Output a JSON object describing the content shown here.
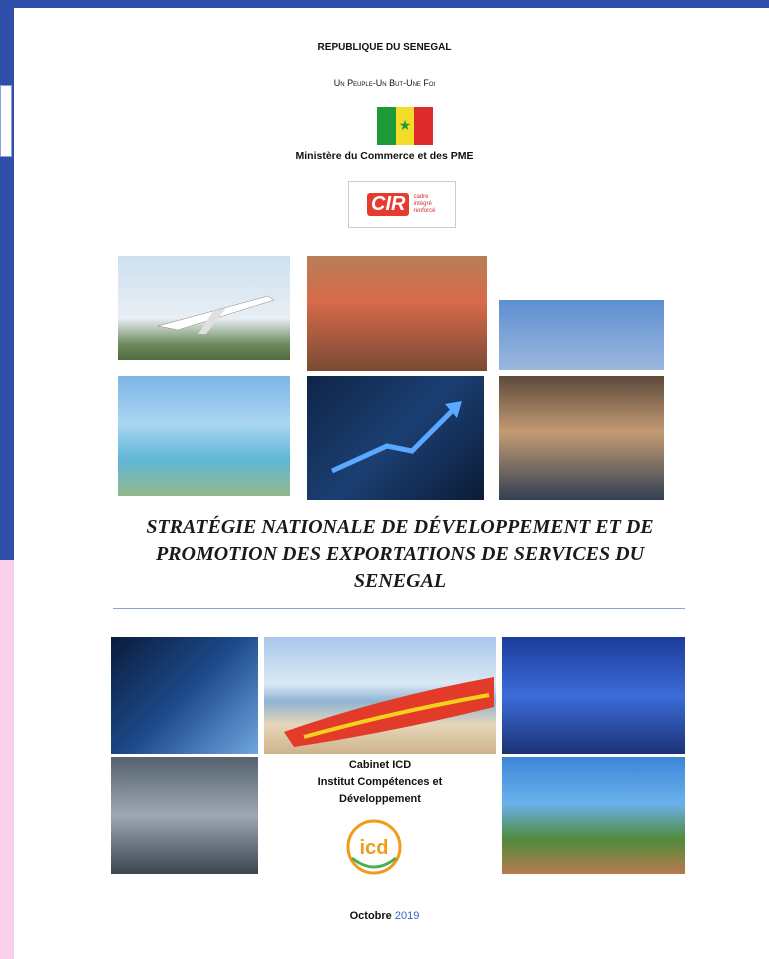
{
  "header": {
    "republic": "REPUBLIQUE DU SENEGAL",
    "motto": "Un Peuple-Un But-Une Foi",
    "ministry": "Ministère du Commerce et des PME"
  },
  "logos": {
    "cir": {
      "main": "CIR",
      "line1": "cadre",
      "line2": "intégré",
      "line3": "renforcé"
    },
    "icd": {
      "text": "icd"
    }
  },
  "colors": {
    "accent_blue": "#2f4faa",
    "rule_blue": "#8ba3d4",
    "flag_green": "#1f9a3a",
    "flag_yellow": "#f4dc2a",
    "flag_red": "#dd2b2b",
    "cir_red": "#e63c2f",
    "icd_orange": "#f29a1a"
  },
  "title": {
    "line1": "STRATÉGIE NATIONALE DE DÉVELOPPEMENT ET DE",
    "line2": "PROMOTION DES EXPORTATIONS DE SERVICES DU",
    "line3": "SENEGAL"
  },
  "author": {
    "line1": "Cabinet ICD",
    "line2": "Institut Compétences et",
    "line3": "Développement"
  },
  "date": {
    "month": "Octobre",
    "year": "2019"
  },
  "icons": {
    "flag": "senegal-flag-icon",
    "star": "star-icon",
    "growth_arrow": "growth-arrow-icon"
  }
}
